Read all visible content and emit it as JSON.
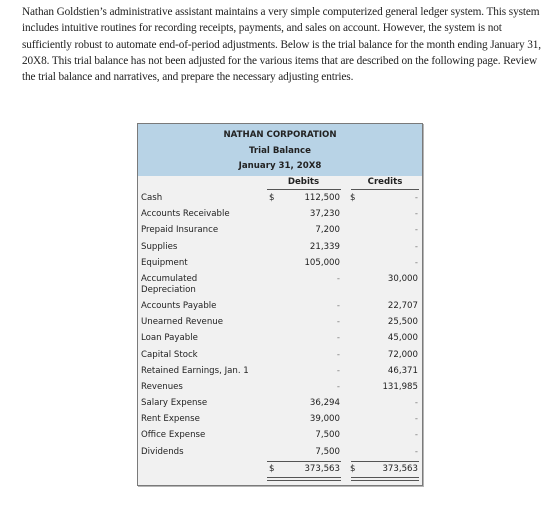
{
  "intro": {
    "text": "Nathan Goldstien’s administrative assistant maintains a very simple computerized general ledger system. This system includes intuitive routines for recording receipts, payments, and sales on account. However, the system is not sufficiently robust to automate end-of-period adjustments. Below is the trial balance for the month ending January 31, 20X8. This trial balance has not been adjusted for the various items that are described on the following page. Review the trial balance and narratives, and prepare the necessary adjusting entries."
  },
  "trial_balance": {
    "company": "NATHAN CORPORATION",
    "title": "Trial Balance",
    "date": "January 31, 20X8",
    "header_color": "#b8d3e6",
    "columns": {
      "debits": "Debits",
      "credits": "Credits"
    },
    "currency_symbol": "$",
    "dash": "-",
    "rows": [
      {
        "account": "Cash",
        "debit": "112,500",
        "credit": "-"
      },
      {
        "account": "Accounts Receivable",
        "debit": "37,230",
        "credit": "-"
      },
      {
        "account": "Prepaid Insurance",
        "debit": "7,200",
        "credit": "-"
      },
      {
        "account": "Supplies",
        "debit": "21,339",
        "credit": "-"
      },
      {
        "account": "Equipment",
        "debit": "105,000",
        "credit": "-"
      },
      {
        "account": "Accumulated Depreciation",
        "debit": "-",
        "credit": "30,000"
      },
      {
        "account": "Accounts Payable",
        "debit": "-",
        "credit": "22,707"
      },
      {
        "account": "Unearned Revenue",
        "debit": "-",
        "credit": "25,500"
      },
      {
        "account": "Loan Payable",
        "debit": "-",
        "credit": "45,000"
      },
      {
        "account": "Capital Stock",
        "debit": "-",
        "credit": "72,000"
      },
      {
        "account": "Retained Earnings, Jan. 1",
        "debit": "-",
        "credit": "46,371"
      },
      {
        "account": "Revenues",
        "debit": "-",
        "credit": "131,985"
      },
      {
        "account": "Salary Expense",
        "debit": "36,294",
        "credit": "-"
      },
      {
        "account": "Rent Expense",
        "debit": "39,000",
        "credit": "-"
      },
      {
        "account": "Office Expense",
        "debit": "7,500",
        "credit": "-"
      },
      {
        "account": "Dividends",
        "debit": "7,500",
        "credit": "-"
      }
    ],
    "totals": {
      "debit": "373,563",
      "credit": "373,563"
    }
  }
}
